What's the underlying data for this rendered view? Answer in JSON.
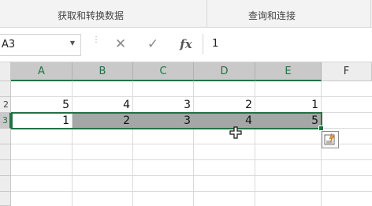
{
  "ribbon": {
    "groups": [
      {
        "label": "获取和转换数据"
      },
      {
        "label": "查询和连接"
      }
    ]
  },
  "formula_bar": {
    "name_box": "A3",
    "cancel_icon": "✕",
    "enter_icon": "✓",
    "fx_label": "fx",
    "formula": "1"
  },
  "sheet": {
    "columns": [
      "A",
      "B",
      "C",
      "D",
      "E",
      "F"
    ],
    "rows": [
      "",
      "2",
      "3",
      "",
      "",
      "",
      "",
      "",
      ""
    ],
    "row2": [
      "5",
      "4",
      "3",
      "2",
      "1"
    ],
    "row3": [
      "1",
      "2",
      "3",
      "4",
      "5"
    ]
  },
  "colors": {
    "accent": "#217346",
    "selection": "#a6a6a6"
  },
  "icons": {
    "cursor": "move-cross-cursor-icon",
    "quick_analysis": "quick-analysis-icon"
  }
}
